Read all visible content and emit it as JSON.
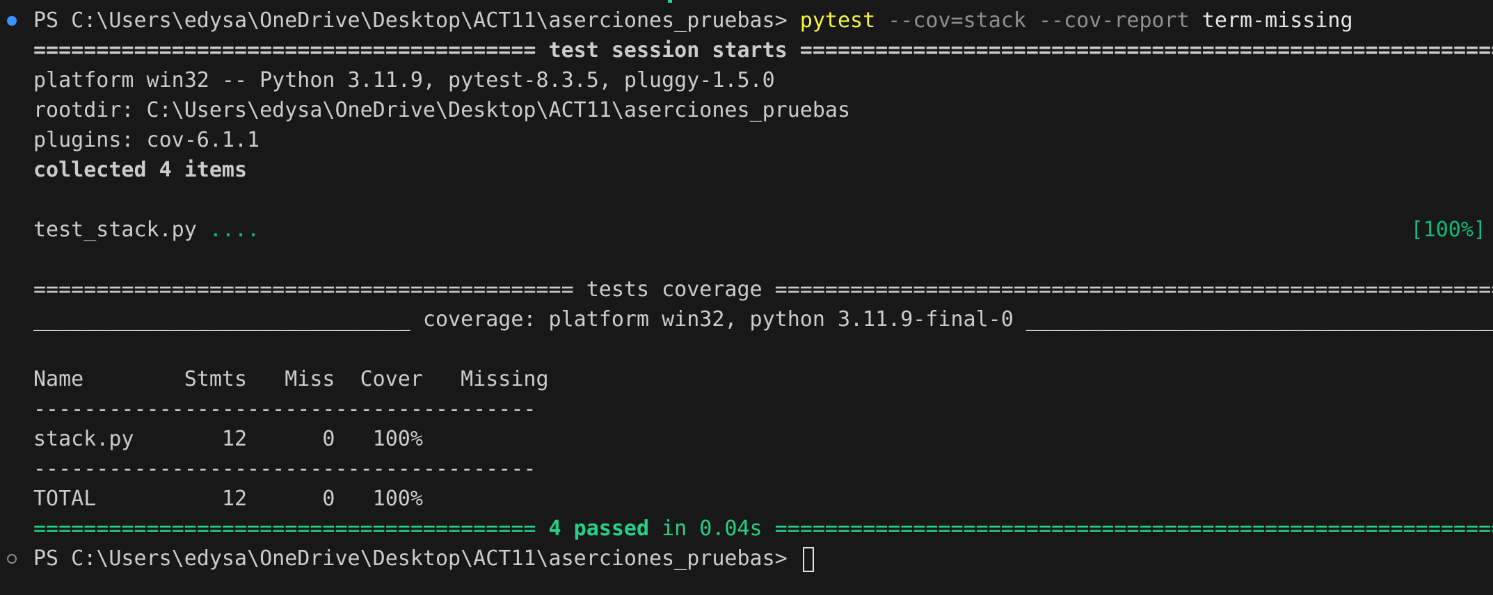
{
  "prompt": {
    "prefix": "PS C:\\Users\\edysa\\OneDrive\\Desktop\\ACT11\\aserciones_pruebas> ",
    "command": "pytest",
    "arg1": " --cov=stack",
    "arg2": " --cov-report",
    "arg3": " term-missing"
  },
  "session": {
    "header_left": "======================================== ",
    "header_title": "test session starts",
    "header_right": " ===========================================================",
    "platform": "platform win32 -- Python 3.11.9, pytest-8.3.5, pluggy-1.5.0",
    "rootdir": "rootdir: C:\\Users\\edysa\\OneDrive\\Desktop\\ACT11\\aserciones_pruebas",
    "plugins": "plugins: cov-6.1.1",
    "collected": "collected 4 items",
    "test_file": "test_stack.py ",
    "test_dots": "....",
    "progress": "[100%]"
  },
  "coverage": {
    "header": "=========================================== tests coverage ==========================================================",
    "subheader": "______________________________ coverage: platform win32, python 3.11.9-final-0 _______________________________________",
    "columns": "Name        Stmts   Miss  Cover   Missing",
    "separator": "----------------------------------------",
    "rows": [
      "stack.py       12      0   100%",
      "TOTAL          12      0   100%"
    ]
  },
  "summary": {
    "left": "======================================== ",
    "passed": "4 passed",
    "in_time": " in 0.04s",
    "right": " ==========================================================="
  },
  "final_prompt": "PS C:\\Users\\edysa\\OneDrive\\Desktop\\ACT11\\aserciones_pruebas> ",
  "colors": {
    "background": "#181818",
    "text": "#cccccc",
    "command": "#f5f543",
    "args": "#8f8f8f",
    "success": "#23d18b",
    "decoration_active": "#3794ff"
  }
}
